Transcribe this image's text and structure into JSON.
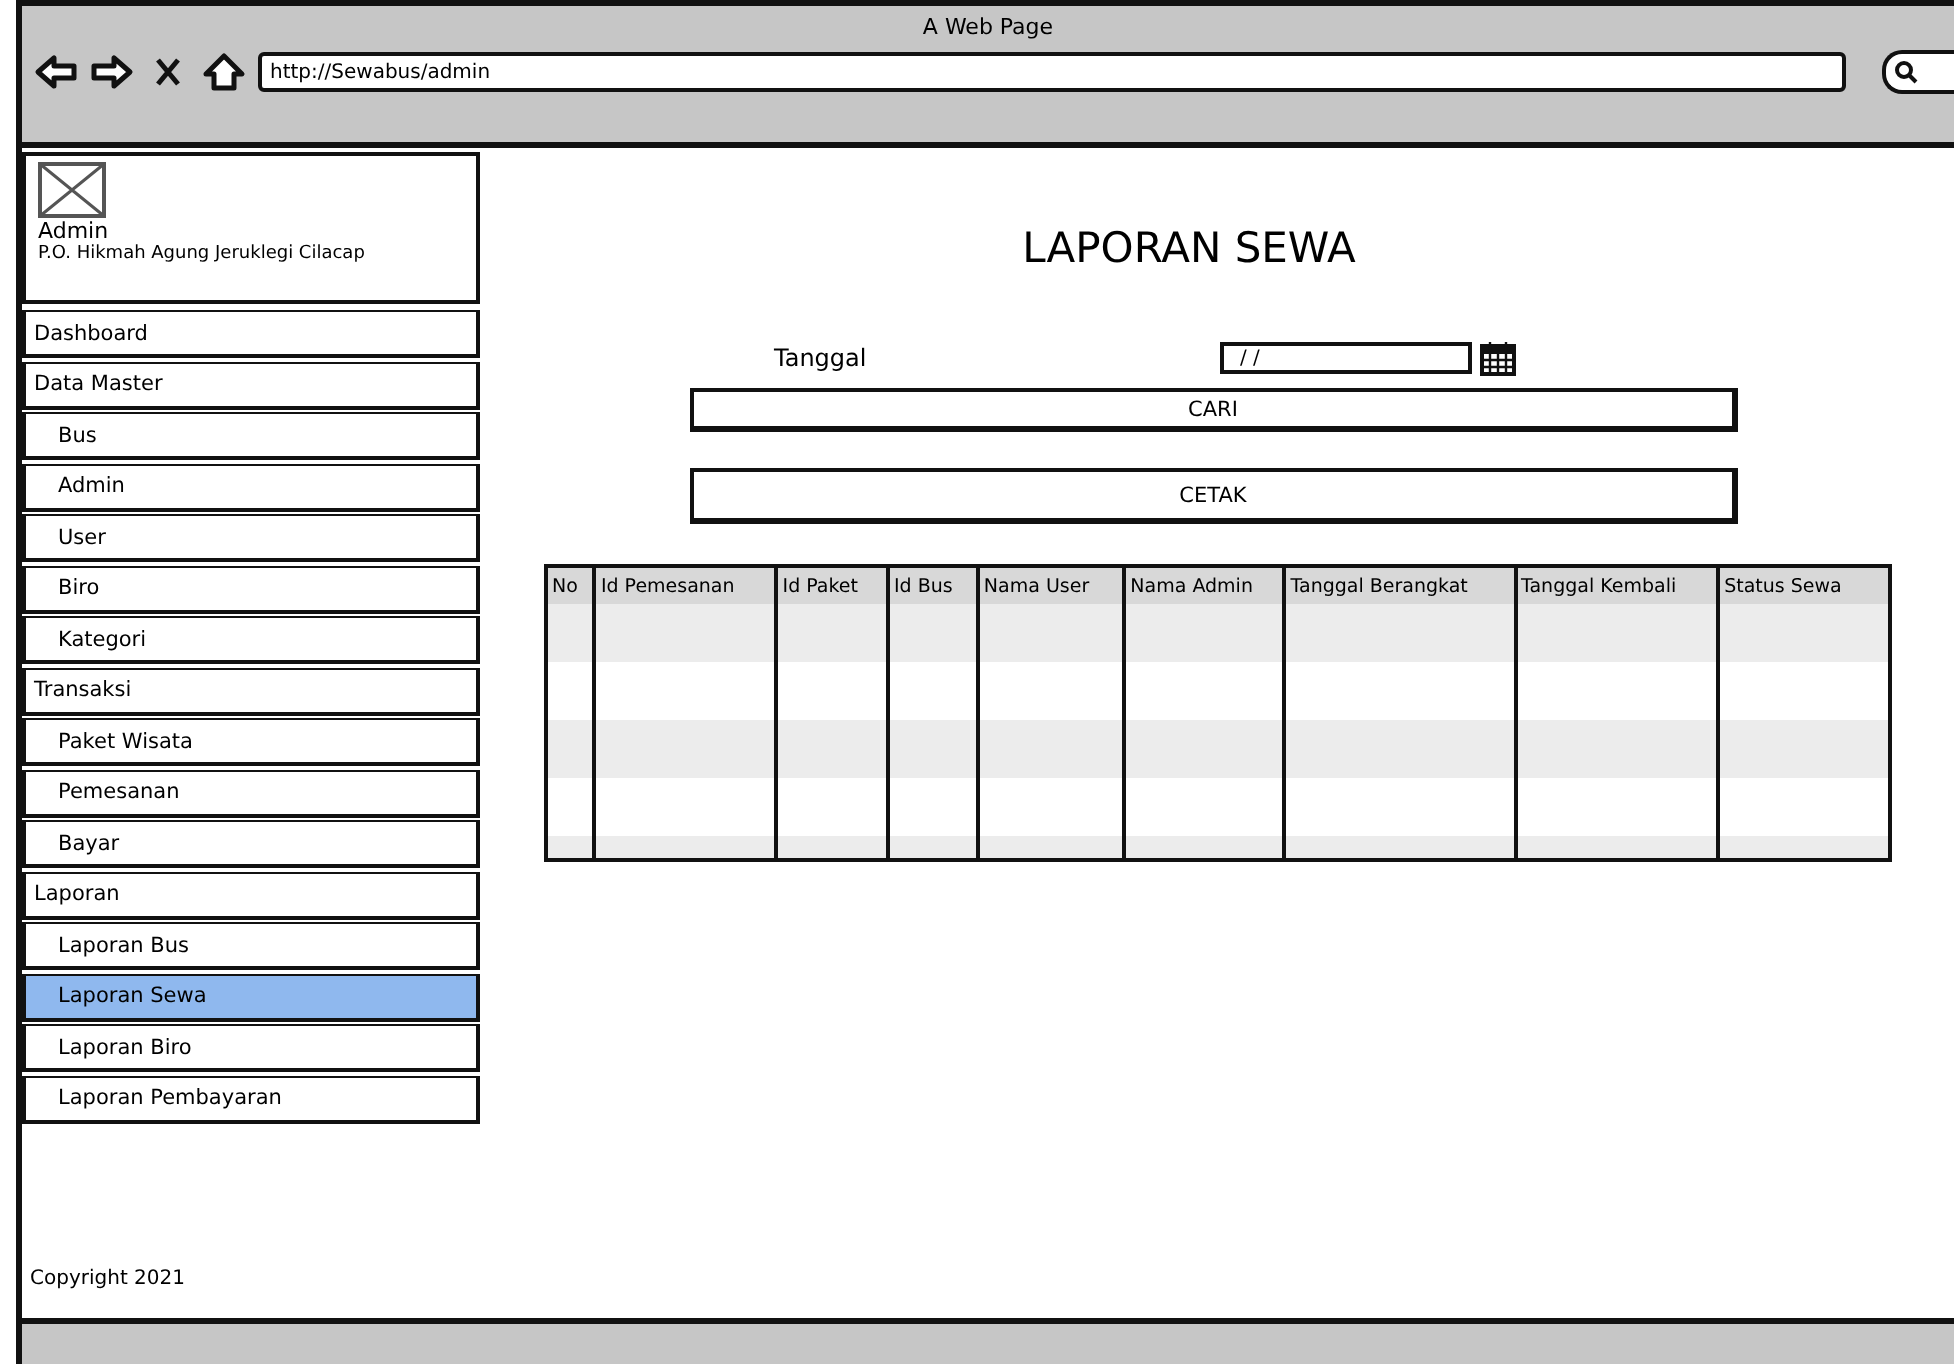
{
  "window": {
    "title": "A Web Page",
    "url": "http://Sewabus/admin"
  },
  "sidebar": {
    "user": "Admin",
    "company": "P.O. Hikmah Agung Jeruklegi Cilacap",
    "items": [
      {
        "label": "Dashboard",
        "kind": "section",
        "selected": false
      },
      {
        "label": "Data Master",
        "kind": "section",
        "selected": false
      },
      {
        "label": "Bus",
        "kind": "sub",
        "selected": false
      },
      {
        "label": "Admin",
        "kind": "sub",
        "selected": false
      },
      {
        "label": "User",
        "kind": "sub",
        "selected": false
      },
      {
        "label": "Biro",
        "kind": "sub",
        "selected": false
      },
      {
        "label": "Kategori",
        "kind": "sub",
        "selected": false
      },
      {
        "label": "Transaksi",
        "kind": "section",
        "selected": false
      },
      {
        "label": "Paket Wisata",
        "kind": "sub",
        "selected": false
      },
      {
        "label": "Pemesanan",
        "kind": "sub",
        "selected": false
      },
      {
        "label": "Bayar",
        "kind": "sub",
        "selected": false
      },
      {
        "label": "Laporan",
        "kind": "section",
        "selected": false
      },
      {
        "label": "Laporan Bus",
        "kind": "sub",
        "selected": false
      },
      {
        "label": "Laporan Sewa",
        "kind": "sub",
        "selected": true
      },
      {
        "label": "Laporan Biro",
        "kind": "sub",
        "selected": false
      },
      {
        "label": "Laporan Pembayaran",
        "kind": "sub",
        "selected": false
      }
    ],
    "footer": "Copyright 2021"
  },
  "main": {
    "title": "LAPORAN SEWA",
    "date_label": "Tanggal",
    "date_value": "/ /",
    "buttons": [
      "CARI",
      "CETAK"
    ],
    "table": {
      "columns": [
        "No",
        "Id Pemesanan",
        "Id Paket",
        "Id Bus",
        "Nama User",
        "Nama Admin",
        "Tanggal Berangkat",
        "Tanggal Kembali",
        "Status Sewa"
      ]
    }
  }
}
